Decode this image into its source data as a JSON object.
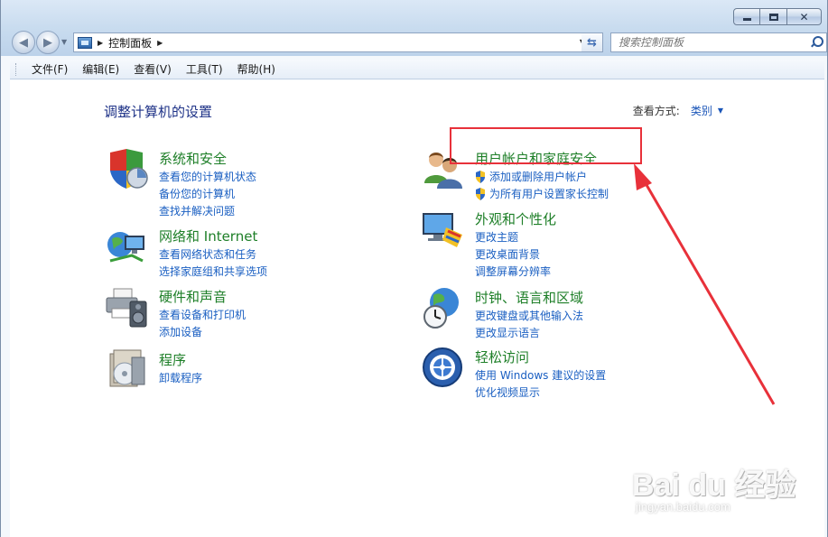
{
  "titlebar": {
    "minimize_icon": "minimize-icon",
    "maximize_icon": "maximize-icon",
    "close_icon": "close-icon"
  },
  "nav": {
    "address": {
      "icon": "control-panel-icon",
      "path": [
        "控制面板"
      ]
    },
    "search": {
      "placeholder": "搜索控制面板"
    }
  },
  "menu": [
    "文件(F)",
    "编辑(E)",
    "查看(V)",
    "工具(T)",
    "帮助(H)"
  ],
  "main": {
    "title": "调整计算机的设置",
    "view_by": {
      "label": "查看方式:",
      "value": "类别"
    }
  },
  "categories": [
    {
      "title": "系统和安全",
      "icon": "system-security-icon",
      "links": [
        {
          "text": "查看您的计算机状态"
        },
        {
          "text": "备份您的计算机"
        },
        {
          "text": "查找并解决问题"
        }
      ]
    },
    {
      "title": "网络和 Internet",
      "icon": "network-icon",
      "links": [
        {
          "text": "查看网络状态和任务"
        },
        {
          "text": "选择家庭组和共享选项"
        }
      ]
    },
    {
      "title": "硬件和声音",
      "icon": "hardware-sound-icon",
      "links": [
        {
          "text": "查看设备和打印机"
        },
        {
          "text": "添加设备"
        }
      ]
    },
    {
      "title": "程序",
      "icon": "programs-icon",
      "links": [
        {
          "text": "卸载程序"
        }
      ]
    },
    {
      "title": "用户帐户和家庭安全",
      "icon": "user-accounts-icon",
      "links": [
        {
          "text": "添加或删除用户帐户",
          "shield": true
        },
        {
          "text": "为所有用户设置家长控制",
          "shield": true
        }
      ]
    },
    {
      "title": "外观和个性化",
      "icon": "appearance-icon",
      "links": [
        {
          "text": "更改主题"
        },
        {
          "text": "更改桌面背景"
        },
        {
          "text": "调整屏幕分辨率"
        }
      ]
    },
    {
      "title": "时钟、语言和区域",
      "icon": "clock-language-icon",
      "links": [
        {
          "text": "更改键盘或其他输入法"
        },
        {
          "text": "更改显示语言"
        }
      ]
    },
    {
      "title": "轻松访问",
      "icon": "ease-of-access-icon",
      "links": [
        {
          "text": "使用 Windows 建议的设置"
        },
        {
          "text": "优化视频显示"
        }
      ]
    }
  ],
  "annotation": {
    "color": "#e8313a"
  },
  "watermark": {
    "main": "Bai du 经验",
    "sub": "jingyan.baidu.com"
  }
}
